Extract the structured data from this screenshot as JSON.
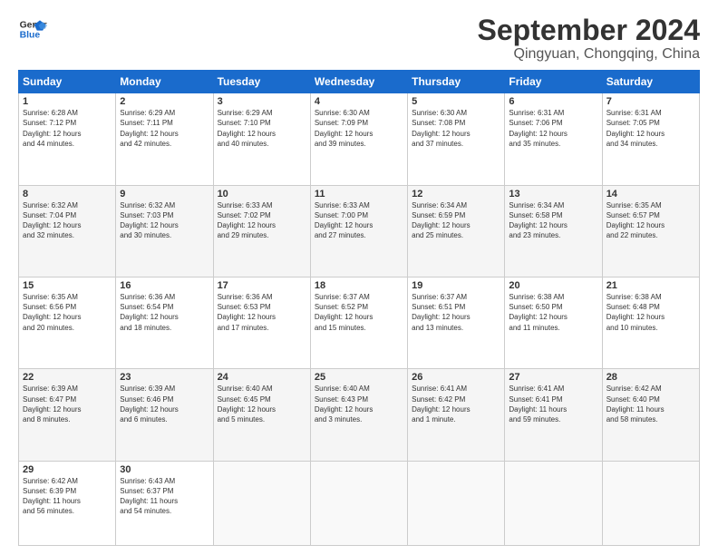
{
  "logo": {
    "line1": "General",
    "line2": "Blue"
  },
  "title": "September 2024",
  "subtitle": "Qingyuan, Chongqing, China",
  "headers": [
    "Sunday",
    "Monday",
    "Tuesday",
    "Wednesday",
    "Thursday",
    "Friday",
    "Saturday"
  ],
  "weeks": [
    [
      {
        "day": "1",
        "info": "Sunrise: 6:28 AM\nSunset: 7:12 PM\nDaylight: 12 hours\nand 44 minutes."
      },
      {
        "day": "2",
        "info": "Sunrise: 6:29 AM\nSunset: 7:11 PM\nDaylight: 12 hours\nand 42 minutes."
      },
      {
        "day": "3",
        "info": "Sunrise: 6:29 AM\nSunset: 7:10 PM\nDaylight: 12 hours\nand 40 minutes."
      },
      {
        "day": "4",
        "info": "Sunrise: 6:30 AM\nSunset: 7:09 PM\nDaylight: 12 hours\nand 39 minutes."
      },
      {
        "day": "5",
        "info": "Sunrise: 6:30 AM\nSunset: 7:08 PM\nDaylight: 12 hours\nand 37 minutes."
      },
      {
        "day": "6",
        "info": "Sunrise: 6:31 AM\nSunset: 7:06 PM\nDaylight: 12 hours\nand 35 minutes."
      },
      {
        "day": "7",
        "info": "Sunrise: 6:31 AM\nSunset: 7:05 PM\nDaylight: 12 hours\nand 34 minutes."
      }
    ],
    [
      {
        "day": "8",
        "info": "Sunrise: 6:32 AM\nSunset: 7:04 PM\nDaylight: 12 hours\nand 32 minutes."
      },
      {
        "day": "9",
        "info": "Sunrise: 6:32 AM\nSunset: 7:03 PM\nDaylight: 12 hours\nand 30 minutes."
      },
      {
        "day": "10",
        "info": "Sunrise: 6:33 AM\nSunset: 7:02 PM\nDaylight: 12 hours\nand 29 minutes."
      },
      {
        "day": "11",
        "info": "Sunrise: 6:33 AM\nSunset: 7:00 PM\nDaylight: 12 hours\nand 27 minutes."
      },
      {
        "day": "12",
        "info": "Sunrise: 6:34 AM\nSunset: 6:59 PM\nDaylight: 12 hours\nand 25 minutes."
      },
      {
        "day": "13",
        "info": "Sunrise: 6:34 AM\nSunset: 6:58 PM\nDaylight: 12 hours\nand 23 minutes."
      },
      {
        "day": "14",
        "info": "Sunrise: 6:35 AM\nSunset: 6:57 PM\nDaylight: 12 hours\nand 22 minutes."
      }
    ],
    [
      {
        "day": "15",
        "info": "Sunrise: 6:35 AM\nSunset: 6:56 PM\nDaylight: 12 hours\nand 20 minutes."
      },
      {
        "day": "16",
        "info": "Sunrise: 6:36 AM\nSunset: 6:54 PM\nDaylight: 12 hours\nand 18 minutes."
      },
      {
        "day": "17",
        "info": "Sunrise: 6:36 AM\nSunset: 6:53 PM\nDaylight: 12 hours\nand 17 minutes."
      },
      {
        "day": "18",
        "info": "Sunrise: 6:37 AM\nSunset: 6:52 PM\nDaylight: 12 hours\nand 15 minutes."
      },
      {
        "day": "19",
        "info": "Sunrise: 6:37 AM\nSunset: 6:51 PM\nDaylight: 12 hours\nand 13 minutes."
      },
      {
        "day": "20",
        "info": "Sunrise: 6:38 AM\nSunset: 6:50 PM\nDaylight: 12 hours\nand 11 minutes."
      },
      {
        "day": "21",
        "info": "Sunrise: 6:38 AM\nSunset: 6:48 PM\nDaylight: 12 hours\nand 10 minutes."
      }
    ],
    [
      {
        "day": "22",
        "info": "Sunrise: 6:39 AM\nSunset: 6:47 PM\nDaylight: 12 hours\nand 8 minutes."
      },
      {
        "day": "23",
        "info": "Sunrise: 6:39 AM\nSunset: 6:46 PM\nDaylight: 12 hours\nand 6 minutes."
      },
      {
        "day": "24",
        "info": "Sunrise: 6:40 AM\nSunset: 6:45 PM\nDaylight: 12 hours\nand 5 minutes."
      },
      {
        "day": "25",
        "info": "Sunrise: 6:40 AM\nSunset: 6:43 PM\nDaylight: 12 hours\nand 3 minutes."
      },
      {
        "day": "26",
        "info": "Sunrise: 6:41 AM\nSunset: 6:42 PM\nDaylight: 12 hours\nand 1 minute."
      },
      {
        "day": "27",
        "info": "Sunrise: 6:41 AM\nSunset: 6:41 PM\nDaylight: 11 hours\nand 59 minutes."
      },
      {
        "day": "28",
        "info": "Sunrise: 6:42 AM\nSunset: 6:40 PM\nDaylight: 11 hours\nand 58 minutes."
      }
    ],
    [
      {
        "day": "29",
        "info": "Sunrise: 6:42 AM\nSunset: 6:39 PM\nDaylight: 11 hours\nand 56 minutes."
      },
      {
        "day": "30",
        "info": "Sunrise: 6:43 AM\nSunset: 6:37 PM\nDaylight: 11 hours\nand 54 minutes."
      },
      {
        "day": "",
        "info": ""
      },
      {
        "day": "",
        "info": ""
      },
      {
        "day": "",
        "info": ""
      },
      {
        "day": "",
        "info": ""
      },
      {
        "day": "",
        "info": ""
      }
    ]
  ]
}
